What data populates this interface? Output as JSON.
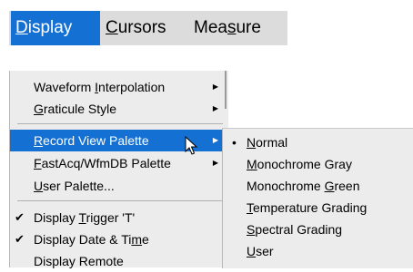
{
  "menubar": {
    "items": [
      {
        "prefix": "",
        "mnemonic": "D",
        "suffix": "isplay"
      },
      {
        "prefix": "",
        "mnemonic": "C",
        "suffix": "ursors"
      },
      {
        "prefix": "Mea",
        "mnemonic": "s",
        "suffix": "ure"
      }
    ]
  },
  "menu": {
    "items": [
      {
        "prefix": "Waveform ",
        "mnemonic": "I",
        "suffix": "nterpolation",
        "checked": false,
        "submenu": true
      },
      {
        "prefix": "",
        "mnemonic": "G",
        "suffix": "raticule Style",
        "checked": false,
        "submenu": true
      },
      {
        "prefix": "",
        "mnemonic": "R",
        "suffix": "ecord View Palette",
        "checked": false,
        "submenu": true,
        "highlighted": true
      },
      {
        "prefix": "",
        "mnemonic": "F",
        "suffix": "astAcq/WfmDB Palette",
        "checked": false,
        "submenu": true
      },
      {
        "prefix": "",
        "mnemonic": "U",
        "suffix": "ser Palette...",
        "checked": false,
        "submenu": false
      },
      {
        "prefix": "Display ",
        "mnemonic": "T",
        "suffix": "rigger 'T'",
        "checked": true,
        "submenu": false
      },
      {
        "prefix": "Display Date & Ti",
        "mnemonic": "m",
        "suffix": "e",
        "checked": true,
        "submenu": false
      },
      {
        "prefix": "Display Remote",
        "mnemonic": "",
        "suffix": "",
        "checked": false,
        "submenu": false
      }
    ],
    "check_glyph": "✔",
    "arrow_glyph": "▶"
  },
  "submenu": {
    "bullet_glyph": "•",
    "items": [
      {
        "prefix": "",
        "mnemonic": "N",
        "suffix": "ormal",
        "selected": true
      },
      {
        "prefix": "",
        "mnemonic": "M",
        "suffix": "onochrome Gray",
        "selected": false
      },
      {
        "prefix": "Monochrome ",
        "mnemonic": "G",
        "suffix": "reen",
        "selected": false
      },
      {
        "prefix": "",
        "mnemonic": "T",
        "suffix": "emperature Grading",
        "selected": false
      },
      {
        "prefix": "",
        "mnemonic": "S",
        "suffix": "pectral Grading",
        "selected": false
      },
      {
        "prefix": "",
        "mnemonic": "U",
        "suffix": "ser",
        "selected": false
      }
    ]
  },
  "icons": {
    "cursor": "mouse-pointer-icon"
  },
  "colors": {
    "highlight": "#1470d3",
    "menubar_bg": "#dcdcdc",
    "menu_bg": "#ececec"
  }
}
